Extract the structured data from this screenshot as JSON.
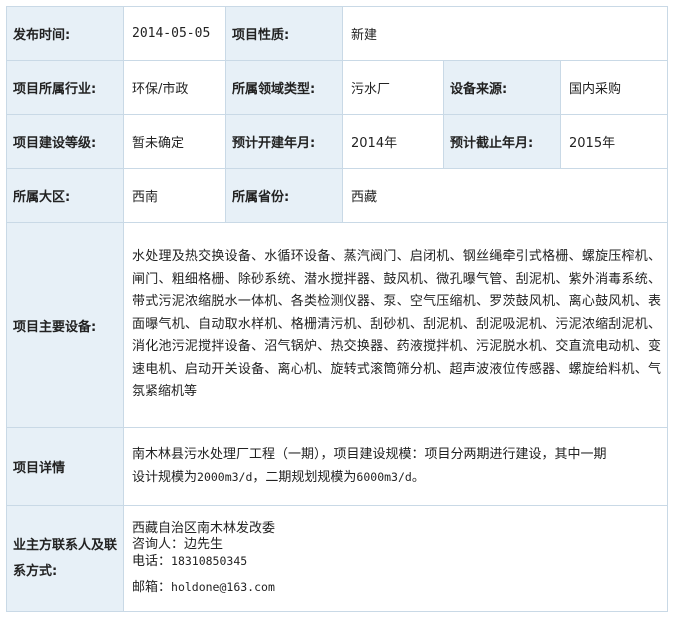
{
  "rows": {
    "publish_time": {
      "label": "发布时间:",
      "value": "2014-05-05"
    },
    "project_nature": {
      "label": "项目性质:",
      "value": "新建"
    },
    "industry": {
      "label": "项目所属行业:",
      "value": "环保/市政"
    },
    "domain_type": {
      "label": "所属领域类型:",
      "value": "污水厂"
    },
    "equipment_source": {
      "label": "设备来源:",
      "value": "国内采购"
    },
    "construction_level": {
      "label": "项目建设等级:",
      "value": "暂未确定"
    },
    "start_year": {
      "label": "预计开建年月:",
      "value": "2014年"
    },
    "end_year": {
      "label": "预计截止年月:",
      "value": "2015年"
    },
    "region": {
      "label": "所属大区:",
      "value": "西南"
    },
    "province": {
      "label": "所属省份:",
      "value": "西藏"
    },
    "main_equipment": {
      "label": "项目主要设备:",
      "value": "水处理及热交换设备、水循环设备、蒸汽阀门、启闭机、钢丝绳牵引式格栅、螺旋压榨机、闸门、粗细格栅、除砂系统、潜水搅拌器、鼓风机、微孔曝气管、刮泥机、紫外消毒系统、带式污泥浓缩脱水一体机、各类检测仪器、泵、空气压缩机、罗茨鼓风机、离心鼓风机、表面曝气机、自动取水样机、格栅清污机、刮砂机、刮泥机、刮泥吸泥机、污泥浓缩刮泥机、消化池污泥搅拌设备、沼气锅炉、热交换器、药液搅拌机、污泥脱水机、交直流电动机、变速电机、启动开关设备、离心机、旋转式滚筒筛分机、超声波液位传感器、螺旋给料机、气氛紧缩机等"
    },
    "project_detail": {
      "label": "项目详情",
      "line1": "南木林县污水处理厂工程（一期），项目建设规模：项目分两期进行建设，其中一期",
      "line2_a": "设计规模为",
      "line2_b": "2000m3/d",
      "line2_c": "，二期规划规模为",
      "line2_d": "6000m3/d",
      "line2_e": "。"
    },
    "contact": {
      "label_line1": "业主方联系人及联",
      "label_line2": "系方式:",
      "org": "西藏自治区南木林发改委",
      "consultant": "咨询人：边先生",
      "phone_label": "电话：",
      "phone": "18310850345",
      "email_label": "邮箱：",
      "email": "holdone@163.com"
    }
  }
}
